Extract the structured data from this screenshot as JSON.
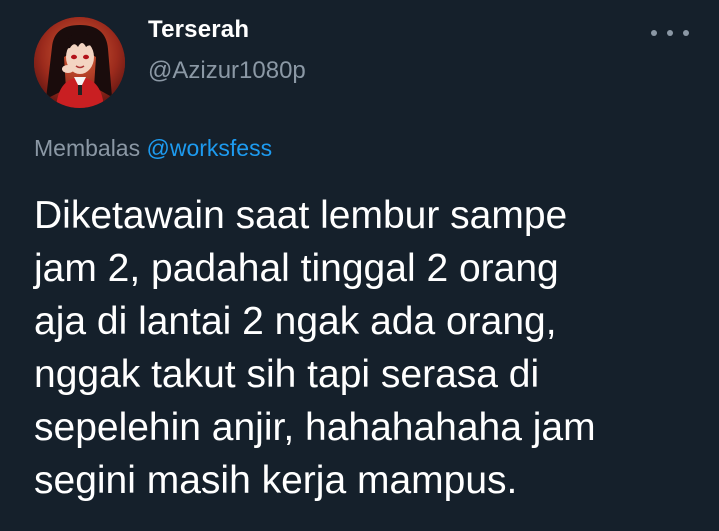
{
  "tweet": {
    "display_name": "Terserah",
    "handle": "@Azizur1080p",
    "reply_prefix": "Membalas",
    "reply_target": "@worksfess",
    "text": "Diketawain saat lembur sampe\njam 2, padahal tinggal 2 orang\naja di lantai 2 ngak ada orang,\nnggak takut sih tapi serasa di\nsepelehin anjir, hahahahaha jam\nsegini masih kerja mampus."
  },
  "icons": {
    "avatar": "anime-avatar",
    "more": "more-options-icon"
  },
  "colors": {
    "background": "#15202b",
    "primary_text": "#ffffff",
    "secondary_text": "#8b98a5",
    "link": "#1d9bf0"
  }
}
